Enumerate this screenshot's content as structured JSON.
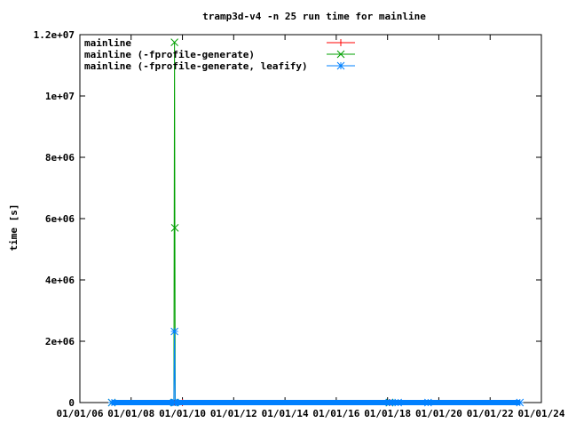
{
  "chart_data": {
    "type": "line",
    "title": "tramp3d-v4 -n 25 run time for mainline",
    "xlabel": "",
    "ylabel": "time [s]",
    "x_axis_type": "date",
    "xlim": [
      "2006-01-01",
      "2024-01-01"
    ],
    "ylim": [
      0,
      12000000
    ],
    "x_tick_labels": [
      "01/01/06",
      "01/01/08",
      "01/01/10",
      "01/01/12",
      "01/01/14",
      "01/01/16",
      "01/01/18",
      "01/01/20",
      "01/01/22",
      "01/01/24"
    ],
    "y_tick_labels": [
      "0",
      "2e+06",
      "4e+06",
      "6e+06",
      "8e+06",
      "1e+07",
      "1.2e+07"
    ],
    "grid": false,
    "legend_position": "top-left",
    "series": [
      {
        "name": "mainline",
        "color": "#ff0000",
        "marker": "plus",
        "points": [
          {
            "x": "2007-04-01",
            "y": 60
          },
          {
            "x": "2010-01-01",
            "y": 60
          },
          {
            "x": "2018-02-01",
            "y": 60
          }
        ]
      },
      {
        "name": "mainline (-fprofile-generate)",
        "color": "#00a000",
        "marker": "cross",
        "points": [
          {
            "x": "2007-04-01",
            "y": 150
          },
          {
            "x": "2009-09-01",
            "y": 150
          },
          {
            "x": "2009-09-10",
            "y": 11750000
          },
          {
            "x": "2009-09-15",
            "y": 5700000
          },
          {
            "x": "2009-09-20",
            "y": 150
          },
          {
            "x": "2018-02-01",
            "y": 150
          }
        ]
      },
      {
        "name": "mainline (-fprofile-generate, leafify)",
        "color": "#0080ff",
        "marker": "star",
        "points": [
          {
            "x": "2007-04-01",
            "y": 200
          },
          {
            "x": "2009-09-01",
            "y": 200
          },
          {
            "x": "2009-09-10",
            "y": 2320000
          },
          {
            "x": "2009-09-20",
            "y": 200
          },
          {
            "x": "2018-01-25",
            "y": 200
          },
          {
            "x": "2018-06-01",
            "y": 200
          },
          {
            "x": "2019-08-01",
            "y": 200
          },
          {
            "x": "2023-03-01",
            "y": 200
          }
        ]
      }
    ]
  }
}
